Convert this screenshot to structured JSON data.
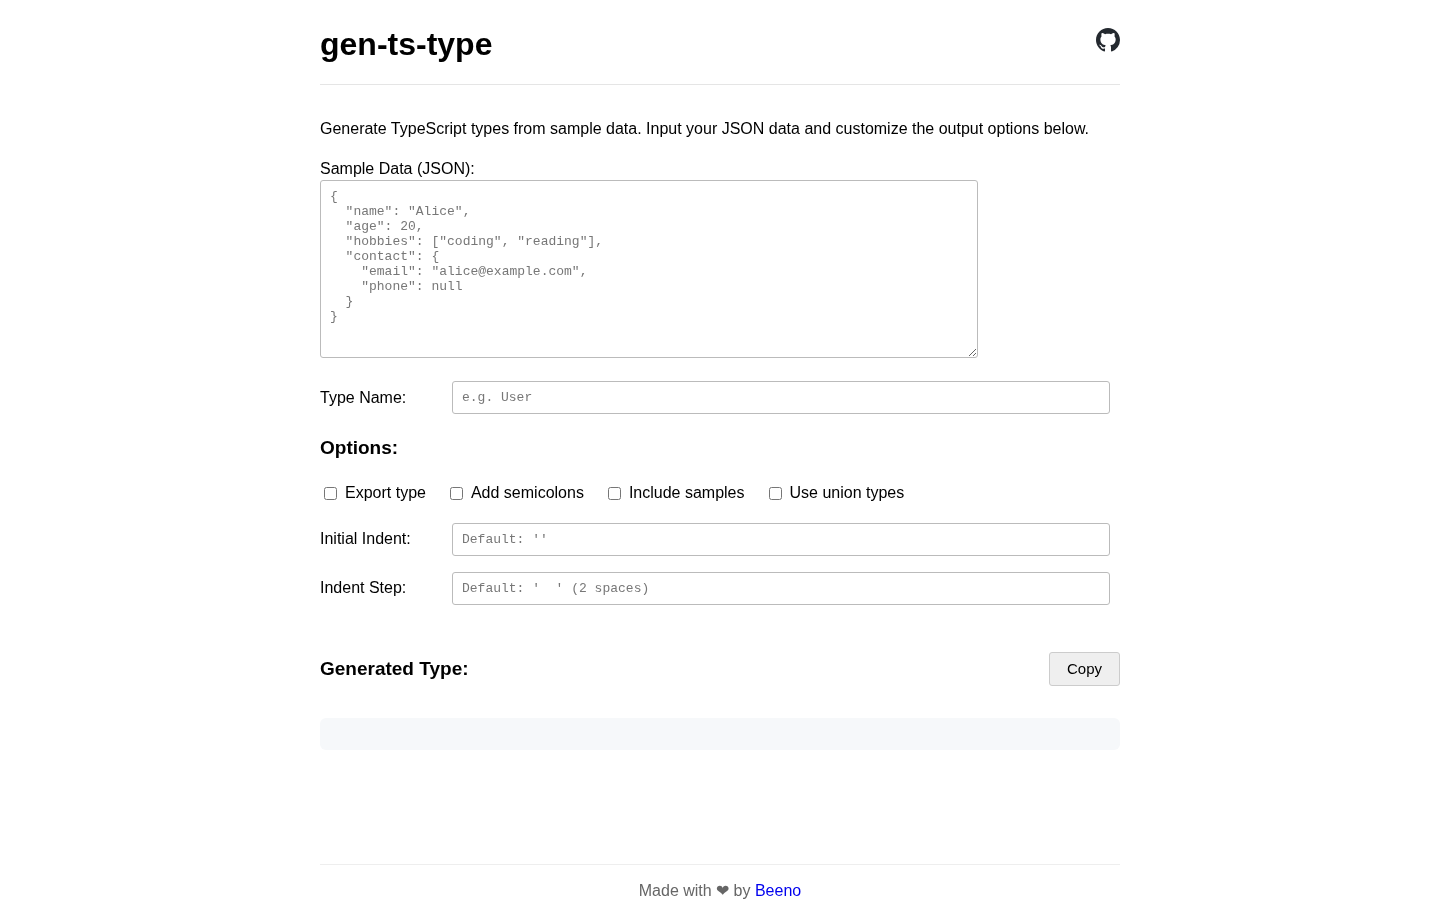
{
  "header": {
    "title": "gen-ts-type"
  },
  "description": "Generate TypeScript types from sample data. Input your JSON data and customize the output options below.",
  "sample_data": {
    "label": "Sample Data (JSON):",
    "placeholder": "{\n  \"name\": \"Alice\",\n  \"age\": 20,\n  \"hobbies\": [\"coding\", \"reading\"],\n  \"contact\": {\n    \"email\": \"alice@example.com\",\n    \"phone\": null\n  }\n}"
  },
  "type_name": {
    "label": "Type Name:",
    "placeholder": "e.g. User"
  },
  "options": {
    "heading": "Options:",
    "checkboxes": [
      {
        "label": "Export type",
        "checked": false
      },
      {
        "label": "Add semicolons",
        "checked": false
      },
      {
        "label": "Include samples",
        "checked": false
      },
      {
        "label": "Use union types",
        "checked": false
      }
    ],
    "fields": [
      {
        "label": "Initial Indent:",
        "placeholder": "Default: ''"
      },
      {
        "label": "Indent Step:",
        "placeholder": "Default: '  ' (2 spaces)"
      }
    ]
  },
  "output": {
    "heading": "Generated Type:",
    "copy_button": "Copy"
  },
  "footer": {
    "text": "Made with ❤ by",
    "link": "Beeno"
  }
}
